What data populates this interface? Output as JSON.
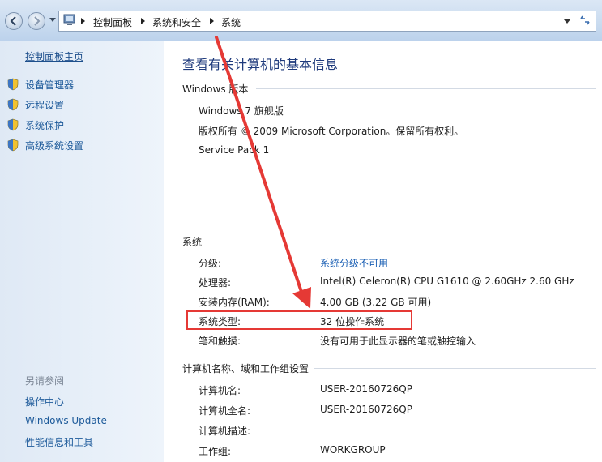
{
  "address_bar": {
    "breadcrumbs": [
      "控制面板",
      "系统和安全",
      "系统"
    ]
  },
  "sidebar": {
    "home_link": "控制面板主页",
    "items": [
      {
        "label": "设备管理器",
        "icon": "shield-icon"
      },
      {
        "label": "远程设置",
        "icon": "shield-icon"
      },
      {
        "label": "系统保护",
        "icon": "shield-icon"
      },
      {
        "label": "高级系统设置",
        "icon": "shield-icon"
      }
    ],
    "see_also_title": "另请参阅",
    "see_also": [
      "操作中心",
      "Windows Update",
      "性能信息和工具"
    ]
  },
  "main": {
    "title": "查看有关计算机的基本信息",
    "edition": {
      "section_title": "Windows 版本",
      "name": "Windows 7 旗舰版",
      "copyright": "版权所有 © 2009 Microsoft Corporation。保留所有权利。",
      "service_pack": "Service Pack 1"
    },
    "system": {
      "section_title": "系统",
      "rows": [
        {
          "label": "分级:",
          "value": "系统分级不可用",
          "is_link": true
        },
        {
          "label": "处理器:",
          "value": "Intel(R) Celeron(R) CPU G1610 @ 2.60GHz   2.60 GHz",
          "is_link": false
        },
        {
          "label": "安装内存(RAM):",
          "value": "4.00 GB (3.22 GB 可用)",
          "is_link": false
        },
        {
          "label": "系统类型:",
          "value": "32 位操作系统",
          "is_link": false
        },
        {
          "label": "笔和触摸:",
          "value": "没有可用于此显示器的笔或触控输入",
          "is_link": false
        }
      ]
    },
    "computer_name": {
      "section_title": "计算机名称、域和工作组设置",
      "rows": [
        {
          "label": "计算机名:",
          "value": "USER-20160726QP"
        },
        {
          "label": "计算机全名:",
          "value": "USER-20160726QP"
        },
        {
          "label": "计算机描述:",
          "value": ""
        },
        {
          "label": "工作组:",
          "value": "WORKGROUP"
        }
      ]
    }
  },
  "colors": {
    "title_blue": "#1e3a7c",
    "link_blue": "#1a5fb4",
    "annotation_red": "#e53935"
  }
}
